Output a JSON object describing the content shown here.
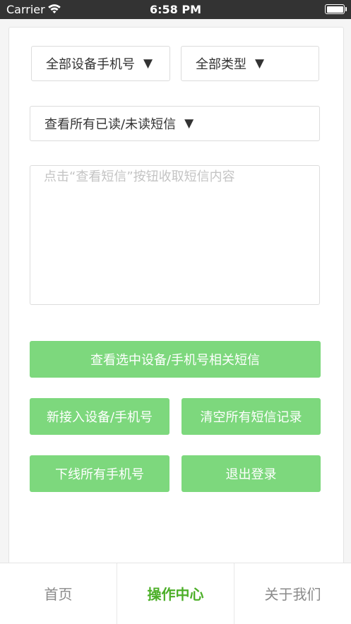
{
  "status_bar": {
    "carrier": "Carrier",
    "time": "6:58 PM"
  },
  "filters": {
    "device": {
      "label": "全部设备手机号",
      "arrow": "▼"
    },
    "type": {
      "label": "全部类型",
      "arrow": "▼"
    },
    "read_status": {
      "label": "查看所有已读/未读短信",
      "arrow": "▼"
    }
  },
  "sms_content": {
    "placeholder": "点击“查看短信”按钮收取短信内容"
  },
  "buttons": {
    "view_sms": "查看选中设备/手机号相关短信",
    "new_device": "新接入设备/手机号",
    "clear_sms": "清空所有短信记录",
    "offline_all": "下线所有手机号",
    "logout": "退出登录"
  },
  "tabs": [
    {
      "label": "首页",
      "active": false
    },
    {
      "label": "操作中心",
      "active": true
    },
    {
      "label": "关于我们",
      "active": false
    }
  ],
  "colors": {
    "accent": "#7dd87d",
    "tab_active": "#4caf28",
    "status_bar": "#333333"
  }
}
